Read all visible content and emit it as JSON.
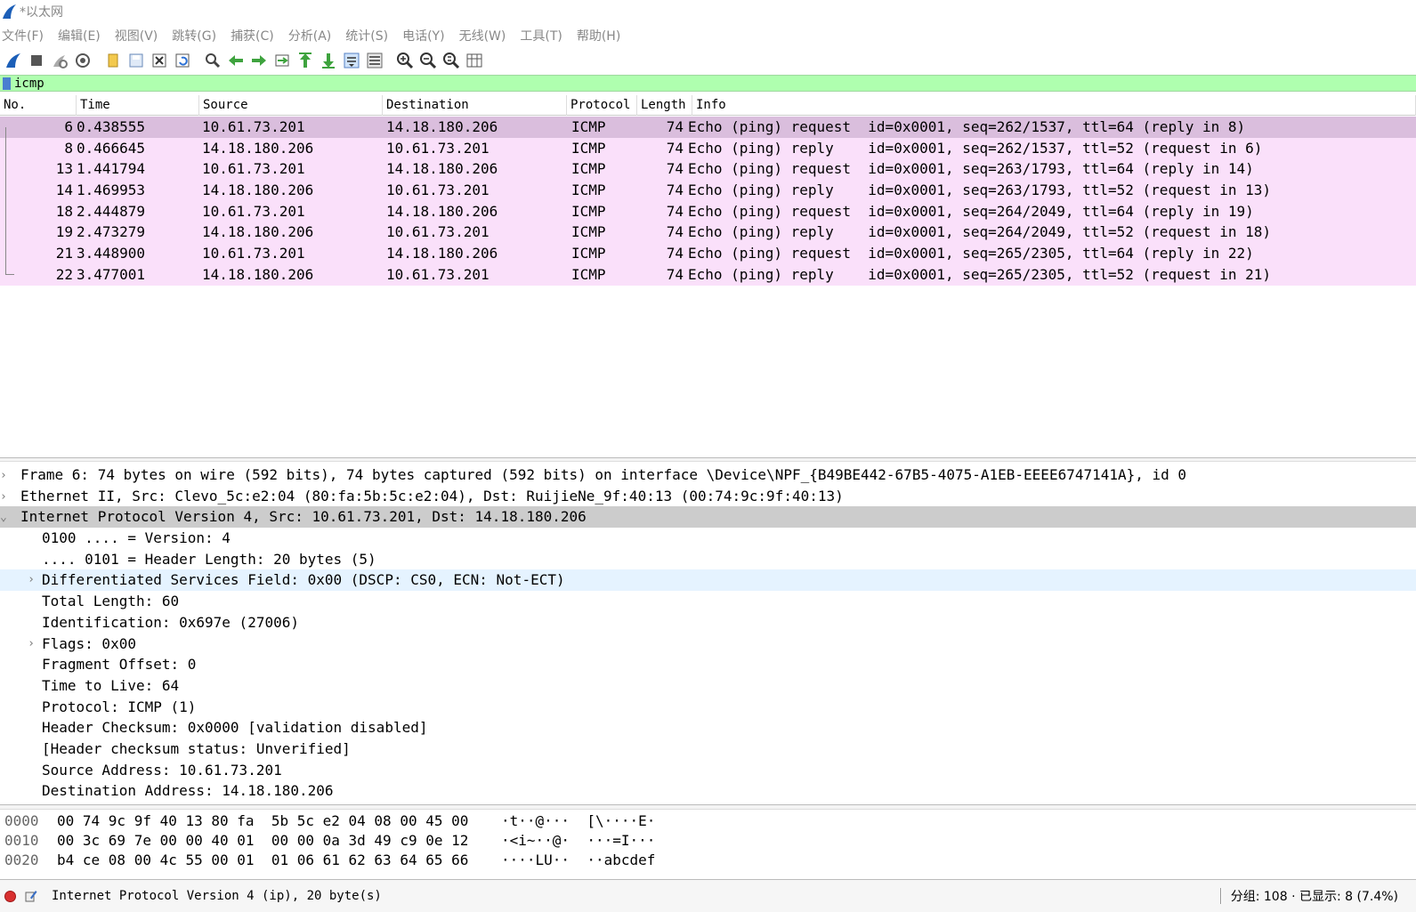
{
  "window": {
    "title": "*以太网"
  },
  "menu": [
    "文件(F)",
    "编辑(E)",
    "视图(V)",
    "跳转(G)",
    "捕获(C)",
    "分析(A)",
    "统计(S)",
    "电话(Y)",
    "无线(W)",
    "工具(T)",
    "帮助(H)"
  ],
  "filter": {
    "value": "icmp"
  },
  "columns": [
    "No.",
    "Time",
    "Source",
    "Destination",
    "Protocol",
    "Length",
    "Info"
  ],
  "packets": [
    {
      "no": "6",
      "time": "0.438555",
      "src": "10.61.73.201",
      "dst": "14.18.180.206",
      "proto": "ICMP",
      "len": "74",
      "info": "Echo (ping) request  id=0x0001, seq=262/1537, ttl=64 (reply in 8)"
    },
    {
      "no": "8",
      "time": "0.466645",
      "src": "14.18.180.206",
      "dst": "10.61.73.201",
      "proto": "ICMP",
      "len": "74",
      "info": "Echo (ping) reply    id=0x0001, seq=262/1537, ttl=52 (request in 6)"
    },
    {
      "no": "13",
      "time": "1.441794",
      "src": "10.61.73.201",
      "dst": "14.18.180.206",
      "proto": "ICMP",
      "len": "74",
      "info": "Echo (ping) request  id=0x0001, seq=263/1793, ttl=64 (reply in 14)"
    },
    {
      "no": "14",
      "time": "1.469953",
      "src": "14.18.180.206",
      "dst": "10.61.73.201",
      "proto": "ICMP",
      "len": "74",
      "info": "Echo (ping) reply    id=0x0001, seq=263/1793, ttl=52 (request in 13)"
    },
    {
      "no": "18",
      "time": "2.444879",
      "src": "10.61.73.201",
      "dst": "14.18.180.206",
      "proto": "ICMP",
      "len": "74",
      "info": "Echo (ping) request  id=0x0001, seq=264/2049, ttl=64 (reply in 19)"
    },
    {
      "no": "19",
      "time": "2.473279",
      "src": "14.18.180.206",
      "dst": "10.61.73.201",
      "proto": "ICMP",
      "len": "74",
      "info": "Echo (ping) reply    id=0x0001, seq=264/2049, ttl=52 (request in 18)"
    },
    {
      "no": "21",
      "time": "3.448900",
      "src": "10.61.73.201",
      "dst": "14.18.180.206",
      "proto": "ICMP",
      "len": "74",
      "info": "Echo (ping) request  id=0x0001, seq=265/2305, ttl=64 (reply in 22)"
    },
    {
      "no": "22",
      "time": "3.477001",
      "src": "14.18.180.206",
      "dst": "10.61.73.201",
      "proto": "ICMP",
      "len": "74",
      "info": "Echo (ping) reply    id=0x0001, seq=265/2305, ttl=52 (request in 21)"
    }
  ],
  "details": [
    {
      "text": "Frame 6: 74 bytes on wire (592 bits), 74 bytes captured (592 bits) on interface \\Device\\NPF_{B49BE442-67B5-4075-A1EB-EEEE6747141A}, id 0",
      "level": 0,
      "arrow": "›",
      "state": ""
    },
    {
      "text": "Ethernet II, Src: Clevo_5c:e2:04 (80:fa:5b:5c:e2:04), Dst: RuijieNe_9f:40:13 (00:74:9c:9f:40:13)",
      "level": 0,
      "arrow": "›",
      "state": ""
    },
    {
      "text": "Internet Protocol Version 4, Src: 10.61.73.201, Dst: 14.18.180.206",
      "level": 0,
      "arrow": "⌄",
      "state": "sel"
    },
    {
      "text": "0100 .... = Version: 4",
      "level": 1,
      "arrow": "",
      "state": ""
    },
    {
      "text": ".... 0101 = Header Length: 20 bytes (5)",
      "level": 1,
      "arrow": "",
      "state": ""
    },
    {
      "text": "Differentiated Services Field: 0x00 (DSCP: CS0, ECN: Not-ECT)",
      "level": 1,
      "arrow": "›",
      "state": "hov"
    },
    {
      "text": "Total Length: 60",
      "level": 1,
      "arrow": "",
      "state": ""
    },
    {
      "text": "Identification: 0x697e (27006)",
      "level": 1,
      "arrow": "",
      "state": ""
    },
    {
      "text": "Flags: 0x00",
      "level": 1,
      "arrow": "›",
      "state": ""
    },
    {
      "text": "Fragment Offset: 0",
      "level": 1,
      "arrow": "",
      "state": ""
    },
    {
      "text": "Time to Live: 64",
      "level": 1,
      "arrow": "",
      "state": ""
    },
    {
      "text": "Protocol: ICMP (1)",
      "level": 1,
      "arrow": "",
      "state": ""
    },
    {
      "text": "Header Checksum: 0x0000 [validation disabled]",
      "level": 1,
      "arrow": "",
      "state": ""
    },
    {
      "text": "[Header checksum status: Unverified]",
      "level": 1,
      "arrow": "",
      "state": ""
    },
    {
      "text": "Source Address: 10.61.73.201",
      "level": 1,
      "arrow": "",
      "state": ""
    },
    {
      "text": "Destination Address: 14.18.180.206",
      "level": 1,
      "arrow": "",
      "state": ""
    }
  ],
  "hex": [
    {
      "offset": "0000",
      "bytes": "00 74 9c 9f 40 13 80 fa  5b 5c e2 04 08 00 45 00",
      "ascii": "·t··@···  [\\····E·"
    },
    {
      "offset": "0010",
      "bytes": "00 3c 69 7e 00 00 40 01  00 00 0a 3d 49 c9 0e 12",
      "ascii": "·<i~··@·  ···=I···"
    },
    {
      "offset": "0020",
      "bytes": "b4 ce 08 00 4c 55 00 01  01 06 61 62 63 64 65 66",
      "ascii": "····LU··  ··abcdef"
    }
  ],
  "status": {
    "text": "Internet Protocol Version 4 (ip), 20 byte(s)",
    "packets": "分组: 108 · 已显示: 8 (7.4%)"
  },
  "toolbar_icons": [
    "shark-fin-start-icon",
    "stop-capture-icon",
    "restart-capture-icon",
    "capture-options-icon",
    "open-file-icon",
    "save-file-icon",
    "close-file-icon",
    "reload-file-icon",
    "find-packet-icon",
    "go-back-icon",
    "go-forward-icon",
    "go-to-packet-icon",
    "first-packet-icon",
    "last-packet-icon",
    "autoscroll-icon",
    "colorize-icon",
    "zoom-in-icon",
    "zoom-out-icon",
    "zoom-normal-icon",
    "resize-columns-icon"
  ],
  "colors": {
    "filter_bg": "#afffaf",
    "row_bg": "#fae0fa",
    "row_selected": "#dabedd",
    "detail_selected": "#cccccc",
    "detail_hover": "#e5f3ff"
  }
}
